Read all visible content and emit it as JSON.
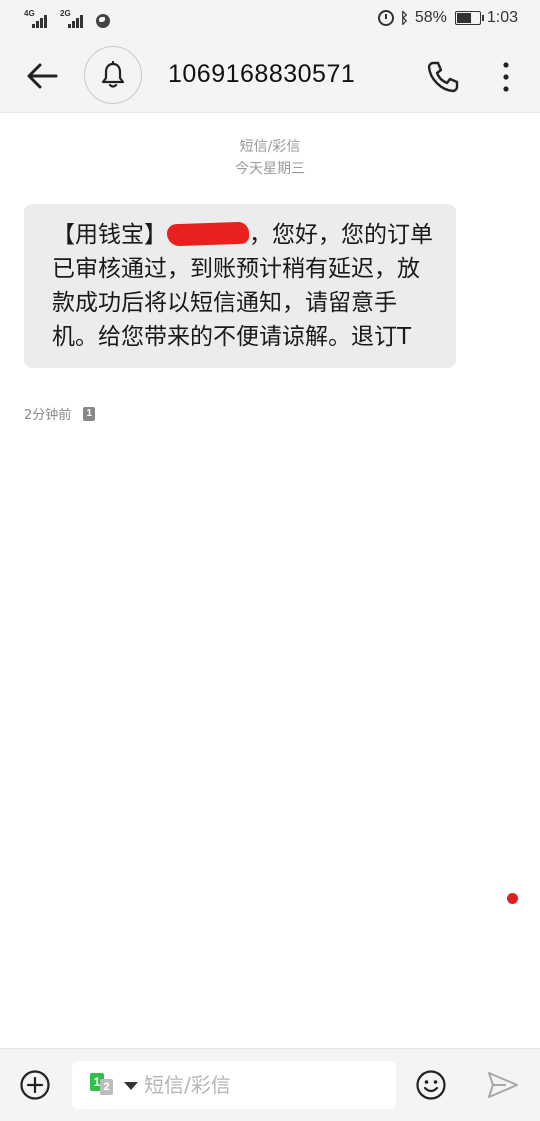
{
  "status_bar": {
    "sim1_network": "4G",
    "sim2_network": "2G",
    "battery_percent": "58%",
    "battery_level": 0.58,
    "time": "1:03",
    "icons": [
      "signal-icon",
      "signal-icon",
      "globe-icon",
      "alarm-icon",
      "bluetooth-icon",
      "battery-icon"
    ]
  },
  "header": {
    "back_icon": "arrow-left-icon",
    "notification_icon": "bell-icon",
    "title": "1069168830571",
    "call_icon": "phone-icon",
    "more_icon": "more-vertical-icon"
  },
  "conversation": {
    "channel_label": "短信/彩信",
    "date_label": "今天星期三",
    "message": {
      "text_before_redaction": "【用钱宝】",
      "text_after_redaction": "，您好，您的订单已审核通过，到账预计稍有延迟，放款成功后将以短信通知，请留意手机。给您带来的不便请谅解。退订T",
      "time": "2分钟前",
      "sim_badge": "1"
    }
  },
  "composer": {
    "add_icon": "plus-circle-icon",
    "sim1_label": "1",
    "sim2_label": "2",
    "placeholder": "短信/彩信",
    "emoji_icon": "smiley-icon",
    "send_icon": "send-icon"
  },
  "colors": {
    "accent_sim1": "#2fbf4a",
    "redaction_mark": "#e8201e",
    "bubble_bg": "#ececec",
    "bar_bg": "#f4f4f4"
  }
}
